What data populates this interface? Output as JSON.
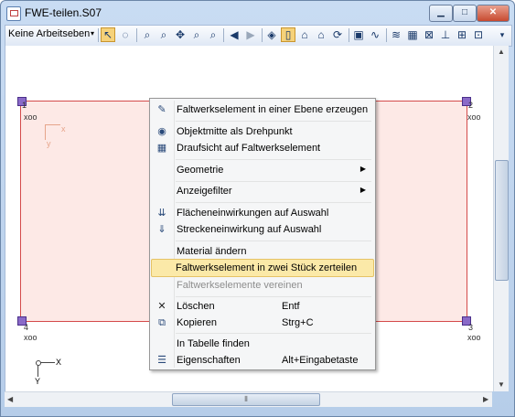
{
  "window": {
    "title": "FWE-teilen.S07",
    "minimize": "▁",
    "maximize": "□",
    "close": "✕"
  },
  "toolbar": {
    "dropdown": "Keine Arbeitseben",
    "dropdown_arrow": "▾",
    "overflow": "▾"
  },
  "nodes": [
    {
      "id": "1",
      "label": "xoo"
    },
    {
      "id": "2",
      "label": "xoo"
    },
    {
      "id": "3",
      "label": "xoo"
    },
    {
      "id": "4",
      "label": "xoo"
    }
  ],
  "local_axes": {
    "x": "x",
    "y": "y"
  },
  "global_axes": {
    "x": "X",
    "y": "Y"
  },
  "scrollbar": {
    "grip": "⦀"
  },
  "context_menu": {
    "items": [
      {
        "label": "Faltwerkselement in einer Ebene erzeugen",
        "icon": "create-plane-icon"
      },
      {
        "label": "Objektmitte als Drehpunkt",
        "icon": "pivot-icon"
      },
      {
        "label": "Draufsicht auf Faltwerkselement",
        "icon": "grid-view-icon"
      },
      {
        "label": "Geometrie",
        "submenu": true
      },
      {
        "label": "Anzeigefilter",
        "submenu": true
      },
      {
        "label": "Flächeneinwirkungen auf Auswahl",
        "icon": "area-load-icon"
      },
      {
        "label": "Streckeneinwirkung auf Auswahl",
        "icon": "line-load-icon"
      },
      {
        "label": "Material ändern"
      },
      {
        "label": "Faltwerkselement in zwei Stück zerteilen",
        "highlighted": true
      },
      {
        "label": "Faltwerkselemente vereinen",
        "disabled": true
      },
      {
        "label": "Löschen",
        "shortcut": "Entf",
        "icon": "delete-icon"
      },
      {
        "label": "Kopieren",
        "shortcut": "Strg+C",
        "icon": "copy-icon"
      },
      {
        "label": "In Tabelle finden"
      },
      {
        "label": "Eigenschaften",
        "shortcut": "Alt+Eingabetaste",
        "icon": "properties-icon"
      }
    ],
    "submenu_arrow": "▶"
  },
  "colors": {
    "plate_fill": "#fde9e6",
    "plate_border": "#d44a4a",
    "node": "#8a6ac8",
    "highlight": "#fbe9a8"
  }
}
